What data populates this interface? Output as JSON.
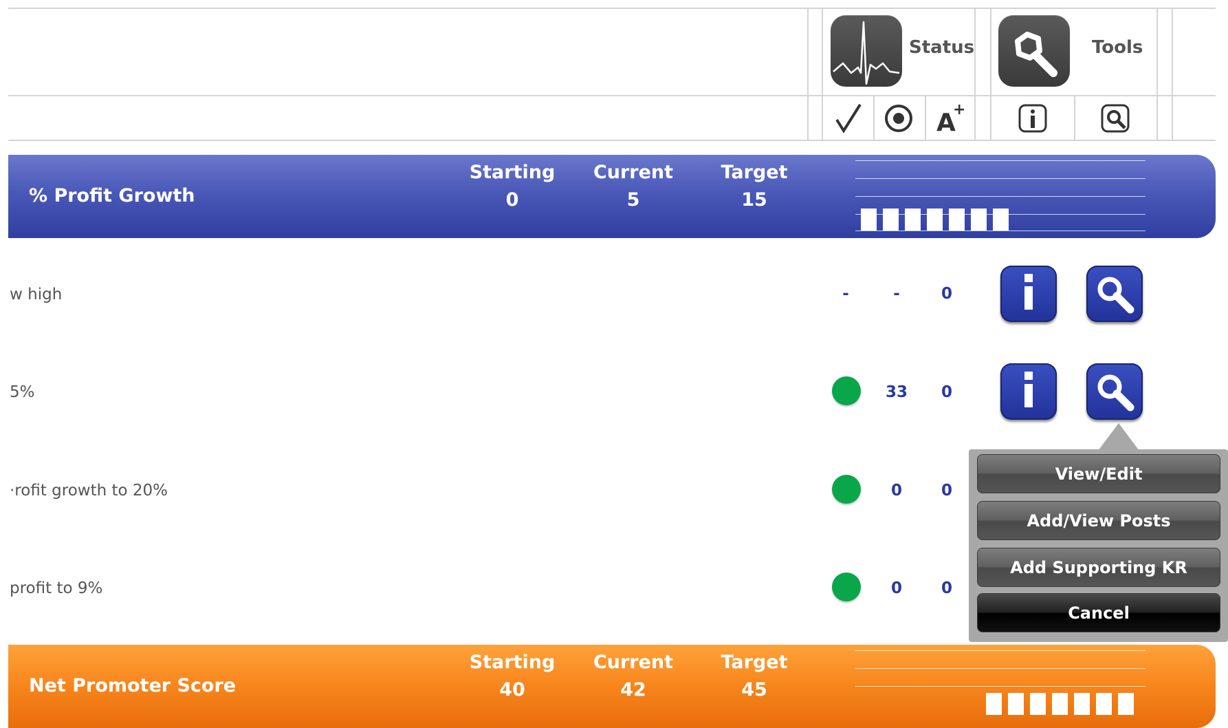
{
  "header": {
    "status_label": "Status",
    "tools_label": "Tools",
    "sub_icons": [
      "check-icon",
      "target-icon",
      "font-size-icon",
      "info-icon",
      "magnifier-icon"
    ]
  },
  "goals": [
    {
      "title": "% Profit Growth",
      "col_starting": "Starting",
      "col_current": "Current",
      "col_target": "Target",
      "starting": "0",
      "current": "5",
      "target": "15",
      "color": "#3f4fb0",
      "progress_bars": 7
    },
    {
      "title": "Net Promoter Score",
      "col_starting": "Starting",
      "col_current": "Current",
      "col_target": "Target",
      "starting": "40",
      "current": "42",
      "target": "45",
      "color": "#f7851c",
      "progress_bars": 7
    }
  ],
  "key_results": [
    {
      "text": "w high",
      "status": "-",
      "current": "-",
      "target": "0"
    },
    {
      "text": "5%",
      "status": "green",
      "current": "33",
      "target": "0"
    },
    {
      "text": "·rofit growth to 20%",
      "status": "green",
      "current": "0",
      "target": "0"
    },
    {
      "text": " profit to 9%",
      "status": "green",
      "current": "0",
      "target": "0"
    }
  ],
  "popover": {
    "view_edit": "View/Edit",
    "add_view_posts": "Add/View Posts",
    "add_supporting_kr": "Add Supporting KR",
    "cancel": "Cancel"
  },
  "colors": {
    "status_green": "#0aa64a",
    "button_blue": "#2a39a0",
    "value_blue": "#2a39a0"
  }
}
